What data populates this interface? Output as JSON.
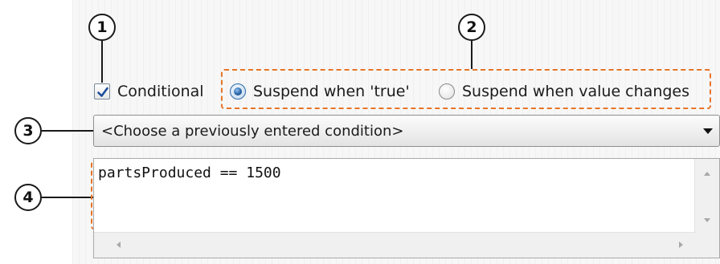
{
  "callouts": [
    "1",
    "2",
    "3",
    "4"
  ],
  "condition": {
    "checkbox_label": "Conditional",
    "checked": true,
    "suspend_options": [
      "Suspend when 'true'",
      "Suspend when value changes"
    ],
    "selected_option": 0,
    "history_dropdown": "<Choose a previously entered condition>",
    "expression": "partsProduced == 1500"
  },
  "colors": {
    "callout_dashes": "#e8742a",
    "radio_selected": "#2a64a6"
  }
}
